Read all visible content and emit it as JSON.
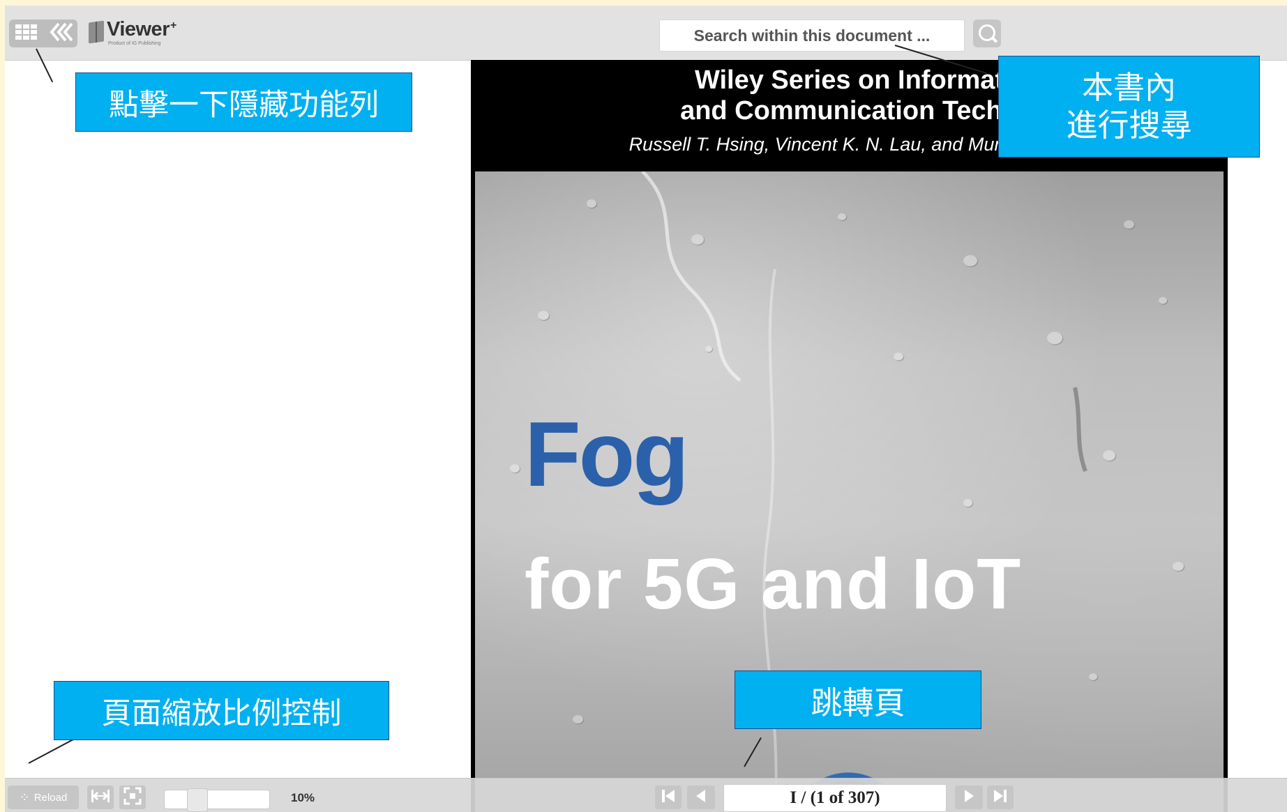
{
  "toolbar": {
    "grid_icon": "grid-icon",
    "collapse_icon": "double-chevron-left-icon",
    "logo_text": "Viewer",
    "logo_superscript": "+",
    "logo_subtitle": "Product of IG Publishing"
  },
  "search": {
    "placeholder": "Search within this document ...",
    "button_icon": "search-icon"
  },
  "book": {
    "series_line1": "Wiley Series on Informat",
    "series_line2": "and Communication Techn",
    "authors": "Russell T. Hsing, Vincent K. N. Lau, and Mung Chian",
    "title_line1": "Fog",
    "title_line2": "for 5G and IoT"
  },
  "bottombar": {
    "reload_label": "Reload",
    "fit_width_icon": "fit-width-icon",
    "fit_page_icon": "fit-page-icon",
    "zoom_value": "10%",
    "zoom_level": 0.1,
    "first_page_icon": "first-page-icon",
    "prev_page_icon": "prev-page-icon",
    "page_display": "I / (1 of 307)",
    "next_page_icon": "next-page-icon",
    "last_page_icon": "last-page-icon"
  },
  "callouts": {
    "hide_toolbar": "點擊一下隱藏功能列",
    "search_in_book_line1": "本書內",
    "search_in_book_line2": "進行搜尋",
    "zoom_control": "頁面縮放比例控制",
    "jump_page": "跳轉頁"
  },
  "colors": {
    "callout_bg": "#00b0f0",
    "cover_title_blue": "#2b61aa",
    "outer_background": "#fdf6d8"
  }
}
